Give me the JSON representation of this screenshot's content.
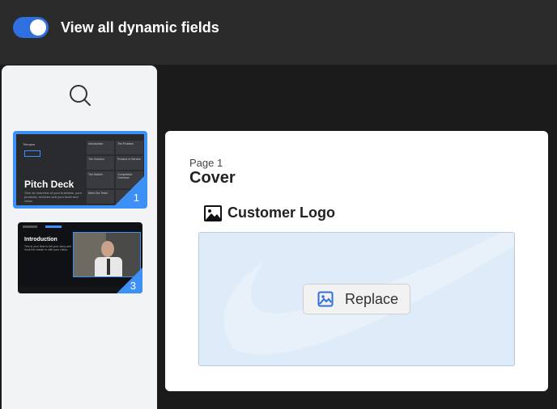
{
  "toolbar": {
    "toggle_on": true,
    "toggle_label": "View all dynamic fields",
    "accent": "#2f6fe0"
  },
  "sidebar": {
    "search_icon": "search-icon",
    "slides": [
      {
        "number": "1",
        "title": "Pitch Deck",
        "tag": "Tiempos",
        "subtitle": "Give an overview of your business, your products, services and your team and vision.",
        "grid": [
          "Introduction",
          "The Problem",
          "The Solution",
          "Product or Service",
          "The Market",
          "Competitive Overview",
          "Meet Our Team",
          ""
        ]
      },
      {
        "number": "3",
        "title": "Introduction",
        "subtitle": "This is your time to tell your story and hook the reader in with your vision."
      }
    ]
  },
  "card": {
    "page_label": "Page 1",
    "page_title": "Cover",
    "field_icon": "image-icon",
    "field_label": "Customer Logo",
    "replace_label": "Replace",
    "replace_icon": "image-icon"
  }
}
